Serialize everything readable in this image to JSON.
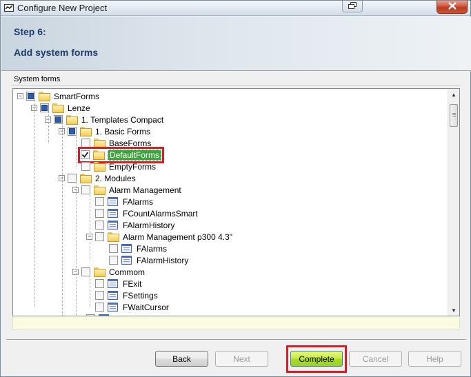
{
  "window": {
    "title": "Configure New Project",
    "icons": {
      "app": "app-icon",
      "restore": "restore-icon",
      "close": "close-icon"
    }
  },
  "header": {
    "step": "Step 6:",
    "subtitle": "Add system forms"
  },
  "group": {
    "label": "System forms"
  },
  "tree": {
    "nodes": [
      {
        "label": "SmartForms",
        "icon": "folder-icon",
        "check": "partial",
        "expander": "minus"
      },
      {
        "label": "Lenze",
        "icon": "folder-icon",
        "check": "partial",
        "expander": "minus"
      },
      {
        "label": "1. Templates Compact",
        "icon": "folder-icon",
        "check": "partial",
        "expander": "minus"
      },
      {
        "label": "1. Basic Forms",
        "icon": "folder-icon",
        "check": "partial",
        "expander": "minus"
      },
      {
        "label": "BaseForms",
        "icon": "folder-icon",
        "check": "unchecked"
      },
      {
        "label": "DefaultForms",
        "icon": "folder-open-icon",
        "check": "checked",
        "selected": true
      },
      {
        "label": "EmptyForms",
        "icon": "folder-icon",
        "check": "unchecked"
      },
      {
        "label": "2. Modules",
        "icon": "folder-icon",
        "check": "unchecked",
        "expander": "minus"
      },
      {
        "label": "Alarm Management",
        "icon": "folder-icon",
        "check": "unchecked",
        "expander": "minus"
      },
      {
        "label": "FAlarms",
        "icon": "form-icon",
        "check": "unchecked"
      },
      {
        "label": "FCountAlarmsSmart",
        "icon": "form-icon",
        "check": "unchecked"
      },
      {
        "label": "FAlarmHistory",
        "icon": "form-icon",
        "check": "unchecked"
      },
      {
        "label": "Alarm Management p300 4.3\"",
        "icon": "folder-icon",
        "check": "unchecked",
        "expander": "minus"
      },
      {
        "label": "FAlarms",
        "icon": "form-icon",
        "check": "unchecked"
      },
      {
        "label": "FAlarmHistory",
        "icon": "form-icon",
        "check": "unchecked"
      },
      {
        "label": "Commom",
        "icon": "folder-icon",
        "check": "unchecked",
        "expander": "minus"
      },
      {
        "label": "FExit",
        "icon": "form-icon",
        "check": "unchecked"
      },
      {
        "label": "FSettings",
        "icon": "form-icon",
        "check": "unchecked"
      },
      {
        "label": "FWaitCursor",
        "icon": "form-icon",
        "check": "unchecked"
      }
    ]
  },
  "buttons": {
    "back": "Back",
    "next": "Next",
    "complete": "Complete",
    "cancel": "Cancel",
    "help": "Help"
  },
  "colors": {
    "highlight_outline": "#d61e26",
    "selection": "#3fa33f",
    "header_text": "#1f3d6b"
  }
}
